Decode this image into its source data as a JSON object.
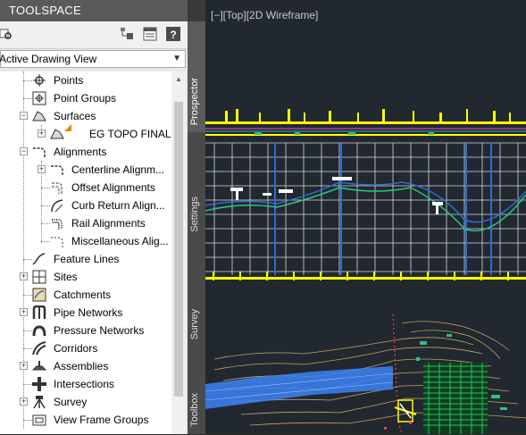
{
  "toolspace": {
    "title": "TOOLSPACE",
    "view_select": "Active Drawing View",
    "tree": [
      {
        "label": "Points"
      },
      {
        "label": "Point Groups"
      },
      {
        "label": "Surfaces"
      },
      {
        "label": "EG TOPO FINAL"
      },
      {
        "label": "Alignments"
      },
      {
        "label": "Centerline Alignm..."
      },
      {
        "label": "Offset Alignments"
      },
      {
        "label": "Curb Return Align..."
      },
      {
        "label": "Rail Alignments"
      },
      {
        "label": "Miscellaneous Alig..."
      },
      {
        "label": "Feature Lines"
      },
      {
        "label": "Sites"
      },
      {
        "label": "Catchments"
      },
      {
        "label": "Pipe Networks"
      },
      {
        "label": "Pressure Networks"
      },
      {
        "label": "Corridors"
      },
      {
        "label": "Assemblies"
      },
      {
        "label": "Intersections"
      },
      {
        "label": "Survey"
      },
      {
        "label": "View Frame Groups"
      }
    ],
    "tabs": [
      "Prospector",
      "Settings",
      "Survey",
      "Toolbox"
    ]
  },
  "viewport": {
    "label": "[−][Top][2D Wireframe]"
  },
  "colors": {
    "title_bar": "#5a5a5a",
    "viewport_bg": "#212830",
    "grid_white": "#ffffff",
    "profile_green": "#2ec27e",
    "profile_blue": "#2f6bd8",
    "yellow_marks": "#ffff00",
    "contour_orange": "#c8a060",
    "hatch_green": "#22c55e",
    "corridor_blue": "#3b82f6"
  }
}
